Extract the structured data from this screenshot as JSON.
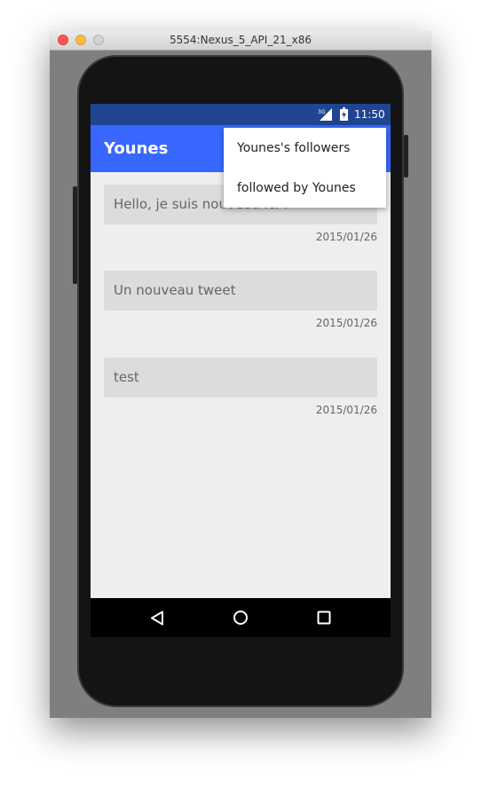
{
  "window": {
    "title": "5554:Nexus_5_API_21_x86"
  },
  "status_bar": {
    "network": "3G",
    "time": "11:50"
  },
  "app_bar": {
    "title": "Younes"
  },
  "overflow_menu": {
    "items": [
      {
        "label": "Younes's followers"
      },
      {
        "label": "followed by Younes"
      }
    ]
  },
  "tweets": [
    {
      "text": "Hello, je suis nouveau ici !",
      "date": "2015/01/26"
    },
    {
      "text": "Un nouveau tweet",
      "date": "2015/01/26"
    },
    {
      "text": "test",
      "date": "2015/01/26"
    }
  ],
  "colors": {
    "status_bar": "#1f4592",
    "app_bar": "#3767ff",
    "screen_background": "#eeeeee",
    "card_background": "#dcdcdc"
  },
  "nav_bar": {
    "icons": [
      "back-icon",
      "home-icon",
      "recents-icon"
    ]
  }
}
